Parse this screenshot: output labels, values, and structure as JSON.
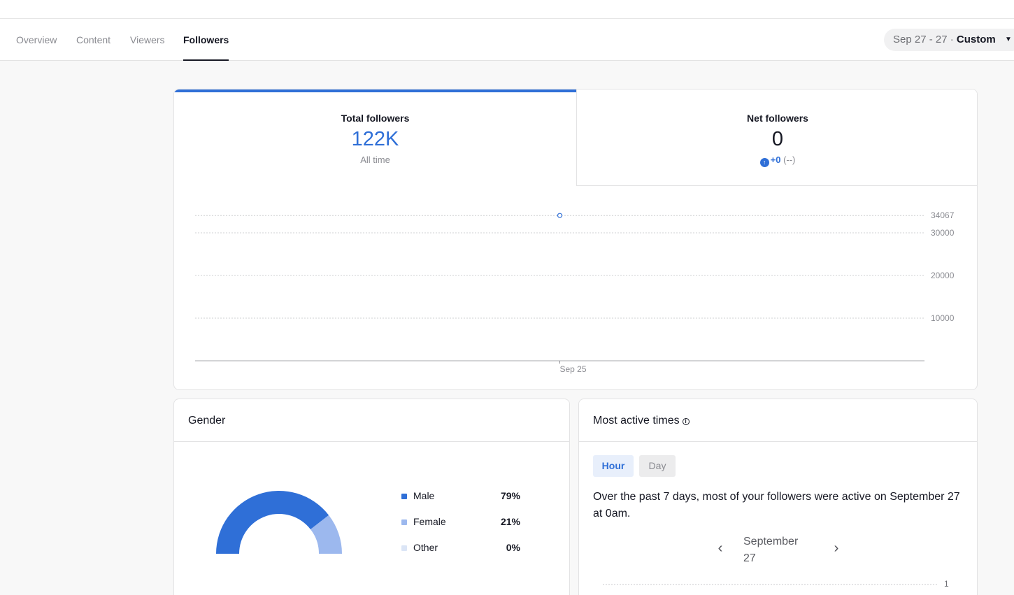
{
  "tabs": [
    {
      "label": "Overview"
    },
    {
      "label": "Content"
    },
    {
      "label": "Viewers"
    },
    {
      "label": "Followers",
      "active": true
    }
  ],
  "date_range": {
    "range": "Sep 27 - 27",
    "separator": "·",
    "mode": "Custom"
  },
  "metrics": {
    "total": {
      "label": "Total followers",
      "value": "122K",
      "sub": "All time"
    },
    "net": {
      "label": "Net followers",
      "value": "0",
      "delta": "+0",
      "delta_note": "(--)"
    }
  },
  "chart_data": {
    "type": "line",
    "x": [
      "Sep 25"
    ],
    "series": [
      {
        "values": [
          34067
        ]
      }
    ],
    "ylim": [
      0,
      34067
    ],
    "yticks": [
      10000,
      20000,
      30000,
      34067
    ],
    "grid": true,
    "accent": "#2f6fd7"
  },
  "gender": {
    "title": "Gender",
    "items": [
      {
        "label": "Male",
        "value": "79%",
        "fraction": 0.79,
        "color": "#2f6fd7"
      },
      {
        "label": "Female",
        "value": "21%",
        "fraction": 0.21,
        "color": "#9cb8ee"
      },
      {
        "label": "Other",
        "value": "0%",
        "fraction": 0.0,
        "color": "#dbe5f6"
      }
    ]
  },
  "active_times": {
    "title": "Most active times",
    "info_icon": "info-icon",
    "toggle": {
      "hour": "Hour",
      "day": "Day"
    },
    "description": "Over the past 7 days, most of your followers were active on September 27 at 0am.",
    "date_line1": "September",
    "date_line2": "27",
    "axis_tick": "1"
  }
}
